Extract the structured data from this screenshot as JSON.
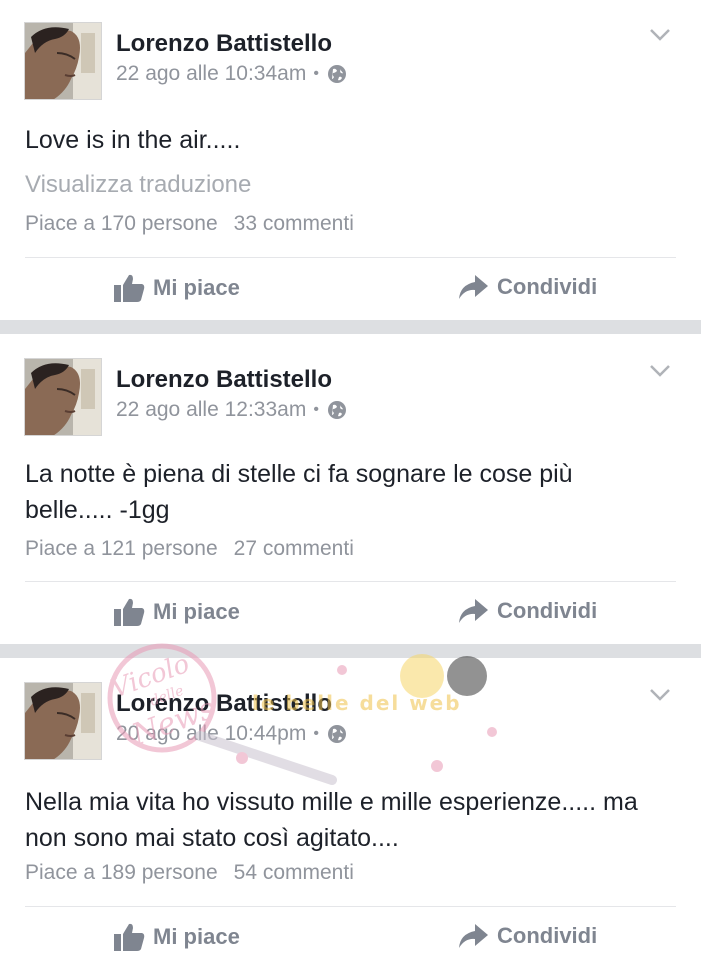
{
  "posts": [
    {
      "author": "Lorenzo Battistello",
      "timestamp": "22 ago alle 10:34am",
      "separator": "•",
      "privacy_icon": "globe-icon",
      "text": "Love is in the air.....",
      "translate_label": "Visualizza traduzione",
      "likes": "Piace a 170 persone",
      "comments": "33 commenti",
      "like_label": "Mi piace",
      "share_label": "Condividi"
    },
    {
      "author": "Lorenzo Battistello",
      "timestamp": "22 ago alle 12:33am",
      "separator": "•",
      "privacy_icon": "globe-icon",
      "text": "La notte è piena di stelle ci fa sognare le cose più belle..... -1gg",
      "likes": "Piace a 121 persone",
      "comments": "27 commenti",
      "like_label": "Mi piace",
      "share_label": "Condividi"
    },
    {
      "author": "Lorenzo Battistello",
      "timestamp": "20 ago alle 10:44pm",
      "separator": "•",
      "privacy_icon": "globe-icon",
      "text": "Nella mia vita ho vissuto mille e mille esperienze..... ma non sono mai stato così agitato....",
      "likes": "Piace a 189 persone",
      "comments": "54 commenti",
      "like_label": "Mi piace",
      "share_label": "Condividi"
    }
  ],
  "watermark": {
    "text_1": "Vicolo",
    "text_2": "delle",
    "text_3": "News",
    "text_4": "le belle del web"
  },
  "colors": {
    "text": "#1d2129",
    "secondary": "#90949c",
    "action": "#7f8590",
    "separator": "#dddfe2"
  }
}
